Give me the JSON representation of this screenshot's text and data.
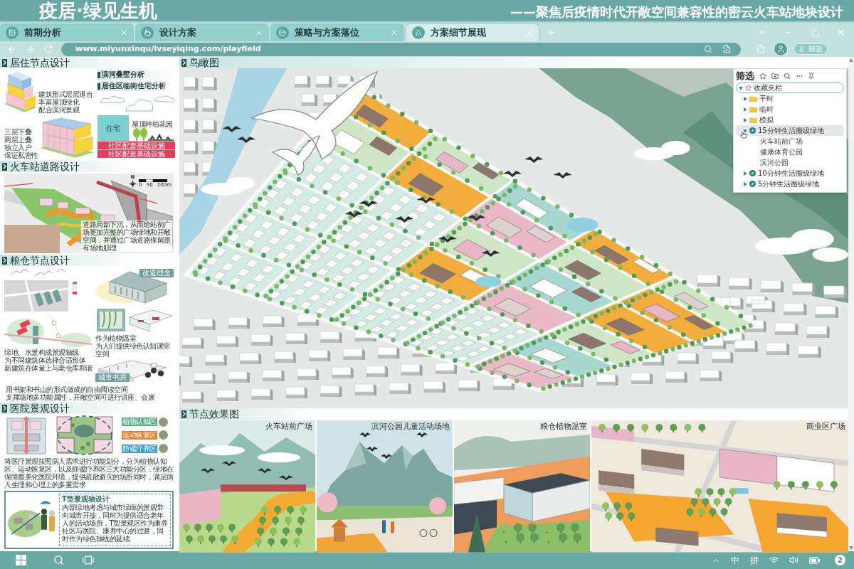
{
  "header": {
    "title": "疫居·绿见生机",
    "subtitle": "——聚焦后疫情时代开敞空间兼容性的密云火车站地块设计"
  },
  "tabs": [
    {
      "label": "前期分析",
      "selected": false
    },
    {
      "label": "设计方案",
      "selected": false
    },
    {
      "label": "策略与方案落位",
      "selected": false
    },
    {
      "label": "方案细节展现",
      "selected": true
    }
  ],
  "address_bar": {
    "url": "www.miyunxinqu/lvseyiqing.com/playfield"
  },
  "filter_button": {
    "label": "筛选"
  },
  "filter_panel": {
    "title": "筛选",
    "tree": [
      {
        "label": "收藏夹栏",
        "expanded": true,
        "children": [
          {
            "label": "平时",
            "kind": "folder",
            "expanded": false,
            "highlighted": false
          },
          {
            "label": "临时",
            "kind": "folder",
            "expanded": false,
            "highlighted": false
          },
          {
            "label": "模拟",
            "kind": "folder",
            "expanded": false,
            "highlighted": false
          },
          {
            "label": "15分钟生活圈级绿地",
            "kind": "group",
            "expanded": true,
            "highlighted": true,
            "children": [
              {
                "label": "火车站前广场"
              },
              {
                "label": "健康体育公园"
              },
              {
                "label": "滨河公园"
              }
            ]
          },
          {
            "label": "10分钟生活圈级绿地",
            "kind": "group",
            "expanded": false,
            "highlighted": false
          },
          {
            "label": "5分钟生活圈级绿地",
            "kind": "group",
            "expanded": false,
            "highlighted": false
          }
        ]
      }
    ]
  },
  "sidebar": {
    "sections": [
      {
        "kind": "residential",
        "heading": "居住节点设计",
        "tags": [
          "滨河叠墅分析",
          "居住区临街住宅分析"
        ],
        "upper_caption": [
          "建筑形式层层退台",
          "丰富屋顶绿化",
          "配合滨河景观"
        ],
        "lower_caption": [
          "三层下叠",
          "两层上叠",
          "独立入户",
          "保证私密性"
        ],
        "building_label": "住宅",
        "garden_label": "屋顶种植花园",
        "base_labels": [
          "社区配套基础设施",
          "社区配套基础设施"
        ]
      },
      {
        "kind": "station",
        "heading": "火车站道路设计",
        "compass": "N",
        "scale_labels": [
          "0",
          "50",
          "200m"
        ],
        "caption": "道路局部下沉，从而给站前广场更加完整的广场绿地和开敞空间，并通过广场道路保留原有场地肌理"
      },
      {
        "kind": "granary",
        "heading": "粮仓节点设计",
        "concept_tag": "改造理念",
        "axis_caption": [
          "绿地、水景构成景观轴线",
          "为不同建筑体选择合适形体",
          "新建筑在体量上与老仓库和谐"
        ],
        "greenhouse_caption": [
          "作为植物温室",
          "为人们提供绿色认知课堂空间"
        ],
        "library_tag": "城市书房",
        "library_caption": [
          "用书架和书山的形式做成的自由阅读空间",
          "支撑场地多功能属性，开敞空间可进行讲座、会展"
        ]
      },
      {
        "kind": "hospital",
        "heading": "医院景观设计",
        "zones": [
          {
            "label": "植物认知区",
            "color": "#5fae8a"
          },
          {
            "label": "运动恢复区",
            "color": "#e07f34"
          },
          {
            "label": "静谧疗养区",
            "color": "#3d9ccf"
          }
        ],
        "caption": "将医疗景观按照病人需求进行功能划分，分为植物认知区、运动恢复区，以及静谧疗养区三大功能分区，绿地在保障最美化医院环境，提供疏散避灾的场所同时，满足病人生理和心理上的多重需求",
        "t_axis": {
          "title": "T型景观轴设计",
          "text": "内部绿地考虑与城市绿廊的景观带向城市开放，同时为提供适合老年人的活动场所，T型景观区作为康养社区与医院、康养中心的过渡，同时作为绿色轴线的延续"
        }
      }
    ]
  },
  "aerial_view": {
    "heading": "鸟瞰图"
  },
  "scenes": {
    "heading": "节点效果图",
    "items": [
      {
        "label": "火车站前广场"
      },
      {
        "label": "滨河公园儿童活动场地"
      },
      {
        "label": "粮仓植物温室"
      },
      {
        "label": "商业区广场"
      }
    ]
  },
  "taskbar": {
    "input_method": [
      "中",
      "拼"
    ],
    "notifications": "2"
  }
}
